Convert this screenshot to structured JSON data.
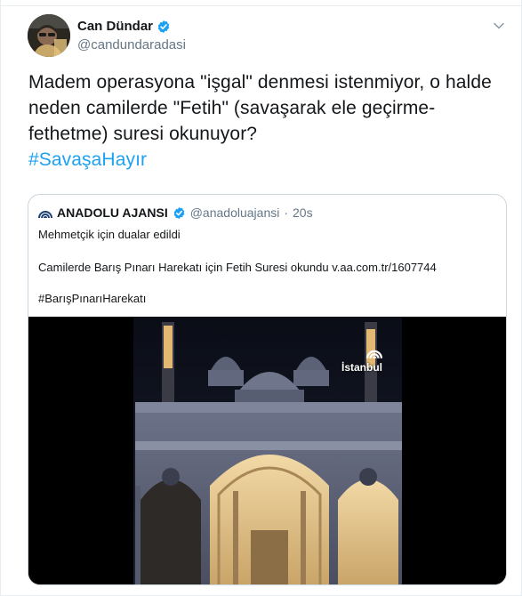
{
  "tweet": {
    "author_name": "Can Dündar",
    "author_handle": "@candundaradasi",
    "text_lines": [
      "Madem operasyona \"işgal\" denmesi istenmiyor, o halde",
      "neden camilerde \"Fetih\" (savaşarak ele geçirme-",
      "fethetme) suresi okunuyor?"
    ],
    "hashtag": "#SavaşaHayır"
  },
  "quote": {
    "author_name": "ANADOLU AJANSI",
    "author_handle": "@anadoluajansi",
    "separator": "·",
    "time": "20s",
    "line1": "Mehmetçik için dualar edildi",
    "line2": "Camilerde Barış Pınarı Harekatı için Fetih Suresi okundu v.aa.com.tr/1607744",
    "line3": "#BarışPınarıHarekatı",
    "video_label": "İstanbul"
  },
  "icons": {
    "verified": "verified-badge-icon",
    "caret": "chevron-down-icon",
    "agency_logo": "anadolu-logo-icon"
  },
  "colors": {
    "link": "#1da1f2",
    "secondary_text": "#657786",
    "border": "#ccd6dd",
    "night_sky": "#000000"
  }
}
